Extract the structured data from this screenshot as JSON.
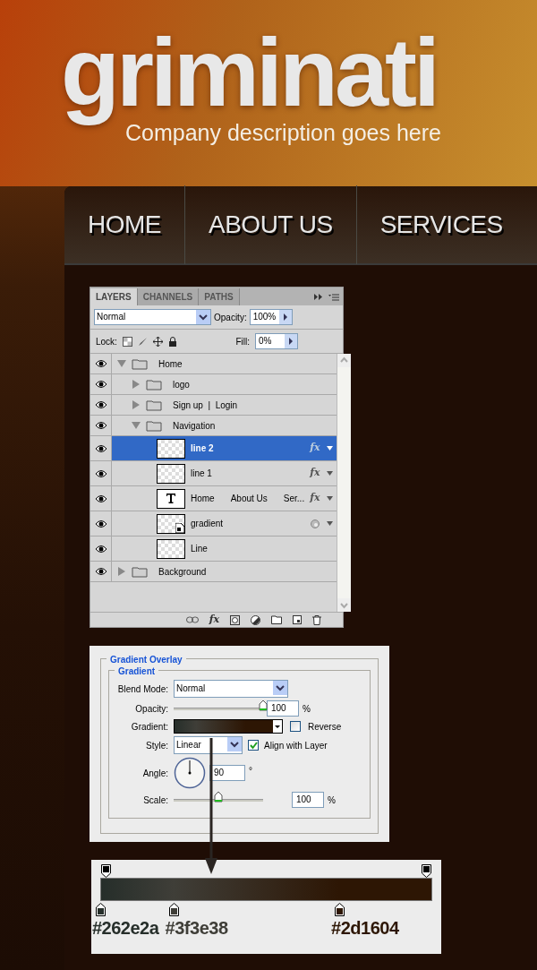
{
  "site": {
    "logo": "griminati",
    "tagline": "Company description goes here",
    "nav": [
      {
        "label": "HOME"
      },
      {
        "label": "ABOUT US"
      },
      {
        "label": "SERVICES"
      }
    ]
  },
  "layers_panel": {
    "tabs": [
      {
        "label": "LAYERS",
        "selected": true
      },
      {
        "label": "CHANNELS",
        "selected": false
      },
      {
        "label": "PATHS",
        "selected": false
      }
    ],
    "footer_effects": "fx",
    "blend_mode": "Normal",
    "opacity_label": "Opacity:",
    "opacity": "100%",
    "lock_label": "Lock:",
    "fill_label": "Fill:",
    "fill": "0%",
    "layers": [
      {
        "kind": "folder",
        "labels": [
          "Home"
        ],
        "visible": true,
        "expanded": true,
        "selected": false,
        "children": [
          {
            "kind": "folder",
            "labels": [
              "logo"
            ],
            "visible": true,
            "expanded": false,
            "selected": false
          },
          {
            "kind": "folder",
            "labels": [
              "Sign up  |  Login"
            ],
            "visible": true,
            "expanded": false,
            "selected": false
          },
          {
            "kind": "folder",
            "labels": [
              "Navigation"
            ],
            "visible": true,
            "expanded": true,
            "selected": false,
            "children": [
              {
                "kind": "pixel",
                "labels": [
                  "line 2"
                ],
                "visible": true,
                "selected": true,
                "effect": "fx"
              },
              {
                "kind": "pixel",
                "labels": [
                  "line 1"
                ],
                "visible": true,
                "selected": false,
                "effect": "fx"
              },
              {
                "kind": "text",
                "labels": [
                  "Home",
                  "About Us",
                  "Ser..."
                ],
                "visible": true,
                "selected": false,
                "effect": "fx"
              },
              {
                "kind": "smart",
                "labels": [
                  "gradient"
                ],
                "visible": true,
                "selected": false,
                "filter_badge": true
              },
              {
                "kind": "pixel",
                "labels": [
                  "Line"
                ],
                "visible": true,
                "selected": false
              }
            ]
          }
        ]
      },
      {
        "kind": "folder",
        "labels": [
          "Background"
        ],
        "visible": true,
        "expanded": false,
        "selected": false
      }
    ]
  },
  "gradient_overlay": {
    "title": "Gradient Overlay",
    "section": "Gradient",
    "blend_mode": {
      "label": "Blend Mode:",
      "value": "Normal"
    },
    "opacity": {
      "label": "Opacity:",
      "value": "100",
      "unit": "%",
      "level": 1
    },
    "gradient": {
      "label": "Gradient:"
    },
    "reverse": {
      "label": "Reverse",
      "checked": false
    },
    "style": {
      "label": "Style:",
      "value": "Linear"
    },
    "align": {
      "label": "Align with Layer",
      "checked": true
    },
    "angle": {
      "label": "Angle:",
      "value": "90",
      "unit": "°"
    },
    "scale": {
      "label": "Scale:",
      "value": "100",
      "unit": "%",
      "level": 0.5
    }
  },
  "gradient_editor": {
    "stops": [
      {
        "label": "#262e2a",
        "color": "#262e2a",
        "level": 0
      },
      {
        "label": "#3f3e38",
        "color": "#3f3e38",
        "level": 0.22
      },
      {
        "label": "#2d1604",
        "color": "#2d1604",
        "level": 0.72
      }
    ]
  }
}
